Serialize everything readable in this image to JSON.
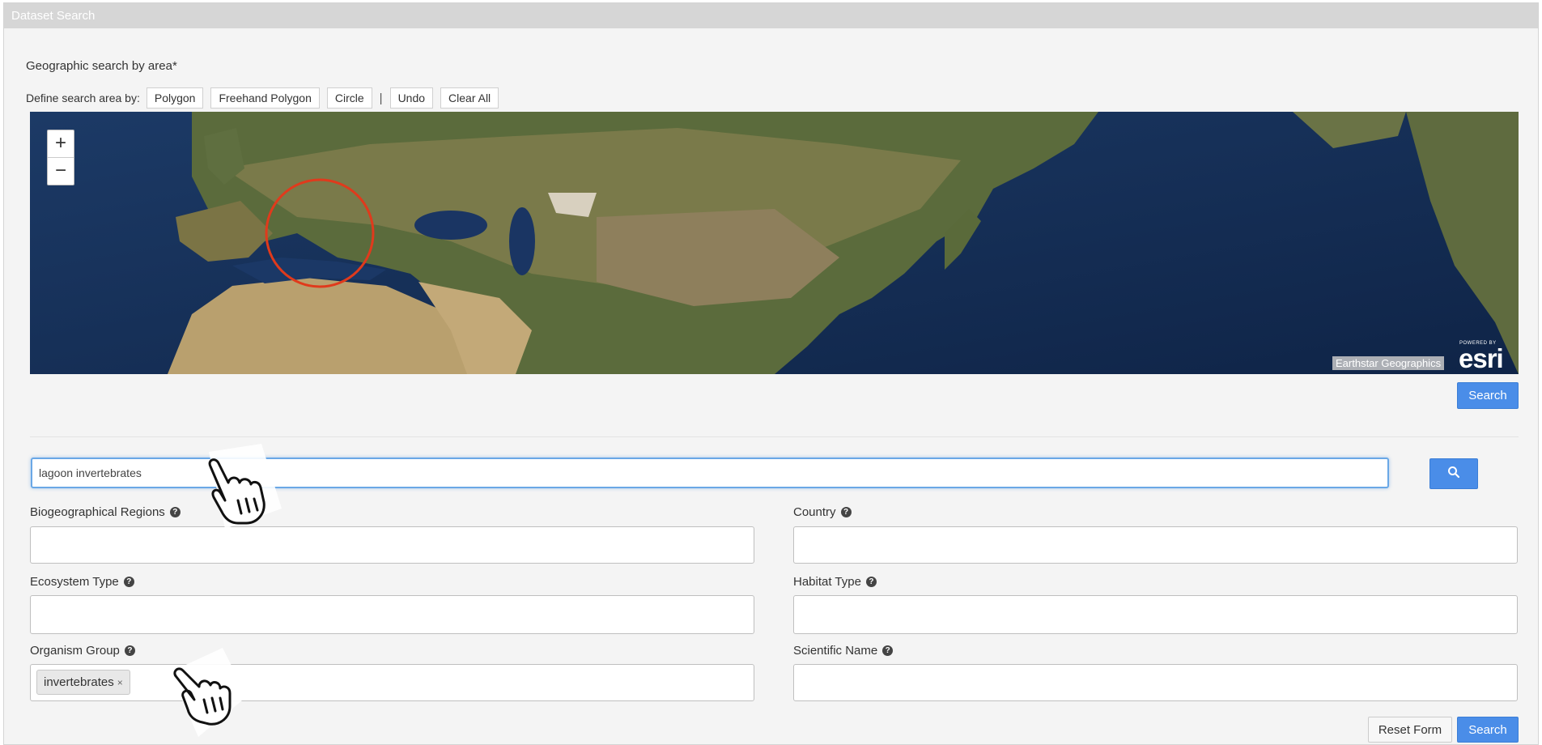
{
  "window": {
    "title": "Dataset Search"
  },
  "geo": {
    "section_title": "Geographic search by area*",
    "define_label": "Define search area by:",
    "tools": [
      {
        "label": "Polygon"
      },
      {
        "label": "Freehand Polygon"
      },
      {
        "label": "Circle"
      }
    ],
    "separator": "|",
    "undo_label": "Undo",
    "clear_all_label": "Clear All",
    "attribution": "Earthstar Geographics",
    "esri_powered": "POWERED BY",
    "esri_logo": "esri",
    "zoom_in": "+",
    "zoom_out": "−",
    "search_label": "Search"
  },
  "keyword": {
    "value": "lagoon invertebrates"
  },
  "fields": {
    "biogeo_label": "Biogeographical Regions",
    "country_label": "Country",
    "ecosystem_label": "Ecosystem Type",
    "habitat_label": "Habitat Type",
    "organism_label": "Organism Group",
    "scientific_label": "Scientific Name",
    "organism_tag": "invertebrates",
    "tag_remove": "×",
    "help_glyph": "?"
  },
  "actions": {
    "reset_label": "Reset Form",
    "search_label": "Search"
  },
  "colors": {
    "accent": "#4a8de8",
    "circle": "#e03a1c"
  }
}
